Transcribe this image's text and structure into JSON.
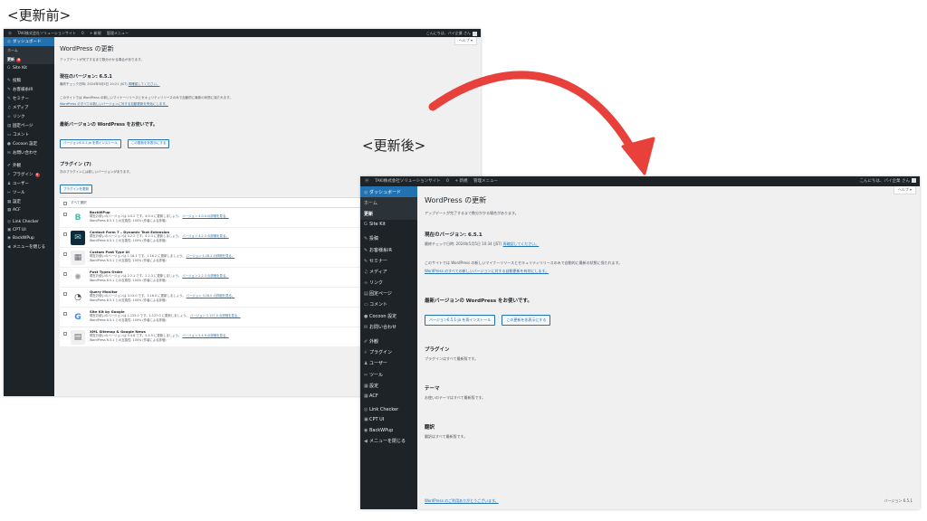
{
  "labels": {
    "before": "<更新前>",
    "after": "<更新後>"
  },
  "colors": {
    "adminbar": "#1d2327",
    "menu_active": "#2271b1",
    "badge": "#d63638",
    "arrow": "#e8403a",
    "link": "#2271b1"
  },
  "adminbar": {
    "site": "TAKI株式会社ソリューションサイト",
    "comments": "0",
    "new": "+ 新規",
    "menu": "管理メニュー",
    "greeting_after": "こんにちは、バイ企業 さん"
  },
  "before": {
    "menu": [
      "ダッシュボード",
      "ホーム",
      "更新",
      "Site Kit",
      "投稿",
      "お客様糸IR",
      "セミナー",
      "メディア",
      "リンク",
      "固定ページ",
      "コメント",
      "Cocoon 設定",
      "お問い合わせ",
      "外観",
      "プラグイン",
      "ユーザー",
      "ツール",
      "設定",
      "ACF",
      "Link Checker",
      "CPT UI",
      "BackWPup",
      "メニューを閉じる"
    ],
    "update_badge": "6",
    "plugin_badge": "6",
    "help": "ヘルプ ▾",
    "title": "WordPress の更新",
    "desc": "アップデートが完了するまで数分かかる場合があります。",
    "current_version_title": "現在のバージョン: 6.5.1",
    "last_check": "最終チェック日時: 2024年5月5日 10:21 (JST)",
    "check_again": "再確認してください。",
    "auto_update": "このサイトでは WordPress の新しいマイナーリリースとセキュリティリリースのみで自動的に最新の状態に保たれます。",
    "auto_update_link": "WordPress のすべての新しいバージョンに対する自動更新を有効にします。",
    "new_version_title": "最新バージョンの WordPress をお使いです。",
    "reinstall_btn": "バージョン6.5.1-ja を再インストール",
    "hide_btn": "この更新を非表示にする",
    "plugins_title": "プラグイン (7)",
    "plugins_desc": "次のプラグインには新しいバージョンがあります。",
    "update_plugins_btn": "プラグインを更新",
    "select_all": "すべて選択",
    "plugins": [
      {
        "name": "BackWPup",
        "line": "現在お使いのバージョンは 4.0.2 です。4.0.4 に更新しましょう。",
        "link": "バージョン 4.0.4 の詳細を見る。",
        "compat": "WordPress 6.5.1 との互換性: 100% (作者による評価)",
        "icon": "B",
        "bg": "#ffffff",
        "fg": "#3cbfae"
      },
      {
        "name": "Contact Form 7 – Dynamic Text Extension",
        "line": "現在お使いのバージョンは 4.2.2 です。4.2.3 に更新しましょう。",
        "link": "バージョン 4.2.3 の詳細を見る。",
        "compat": "WordPress 6.5.1 との互換性: 100% (作者による評価)",
        "icon": "✉",
        "bg": "#0e2b3a",
        "fg": "#7fd6e6"
      },
      {
        "name": "Custom Post Type UI",
        "line": "現在お使いのバージョンは 1.16.1 です。1.16.2 に更新しましょう。",
        "link": "バージョン 1.16.2 の詳細を見る。",
        "compat": "WordPress 6.5.1 との互換性: 100% (作者による評価)",
        "icon": "▦",
        "bg": "#f0f0f1",
        "fg": "#646970"
      },
      {
        "name": "Post Types Order",
        "line": "現在お使いのバージョンは 2.2.1 です。2.2.3 に更新しましょう。",
        "link": "バージョン 2.2.3 の詳細を見る。",
        "compat": "WordPress 6.5.1 との互換性: 100% (作者による評価)",
        "icon": "✺",
        "bg": "#ffffff",
        "fg": "#9aa0a6"
      },
      {
        "name": "Query Monitor",
        "line": "現在お使いのバージョンは 3.15.0 です。3.16.0 に更新しましょう。",
        "link": "バージョン 3.16.0 の詳細を見る。",
        "compat": "WordPress 6.5.1 との互換性: 100% (作者による評価)",
        "icon": "◔",
        "bg": "#ffffff",
        "fg": "#3c434a"
      },
      {
        "name": "Site Kit by Google",
        "line": "現在お使いのバージョンは 1.125.0 です。1.127.0 に更新しましょう。",
        "link": "バージョン 1.127.0 の詳細を見る。",
        "compat": "WordPress 6.5.1 との互換性: 100% (作者による評価)",
        "icon": "G",
        "bg": "#ffffff",
        "fg": "#4285f4"
      },
      {
        "name": "XML Sitemap & Google News",
        "line": "現在お使いのバージョンは 5.4.8 です。5.4.9 に更新しましょう。",
        "link": "バージョン 5.4.9 の詳細を見る。",
        "compat": "WordPress 6.5.1 との互換性: 100% (作者による評価)",
        "icon": "▤",
        "bg": "#f0f0f1",
        "fg": "#646970"
      }
    ]
  },
  "after": {
    "menu": [
      "ダッシュボード",
      "ホーム",
      "更新",
      "Site Kit",
      "投稿",
      "お客様糸IR",
      "セミナー",
      "メディア",
      "リンク",
      "固定ページ",
      "コメント",
      "Cocoon 設定",
      "お問い合わせ",
      "外観",
      "プラグイン",
      "ユーザー",
      "ツール",
      "設定",
      "ACF",
      "Link Checker",
      "CPT UI",
      "BackWPup",
      "メニューを閉じる"
    ],
    "help": "ヘルプ ▾",
    "title": "WordPress の更新",
    "desc": "アップデートが完了するまで数分かかる場合があります。",
    "current_version_title": "現在のバージョン: 6.5.1",
    "last_check": "最終チェック日時: 2024年5月5日 10:34 (JST)",
    "check_again": "再確認してください。",
    "auto_update": "このサイトでは WordPress の新しいマイナーリリースとセキュリティリリースのみで自動的に最新の状態に保たれます。",
    "auto_update_link": "WordPress のすべての新しいバージョンに対する自動更新を有効にします。",
    "new_version_title": "最新バージョンの WordPress をお使いです。",
    "reinstall_btn": "バージョン6.5.1-ja を再インストール",
    "hide_btn": "この更新を非表示にする",
    "plugins_title": "プラグイン",
    "plugins_desc": "プラグインはすべて最新版です。",
    "themes_title": "テーマ",
    "themes_desc": "お使いのテーマはすべて最新版です。",
    "translations_title": "翻訳",
    "translations_desc": "翻訳はすべて最新版です。",
    "footer_left": "WordPress のご利用ありがとうございます。",
    "footer_version": "バージョン 6.5.1"
  }
}
